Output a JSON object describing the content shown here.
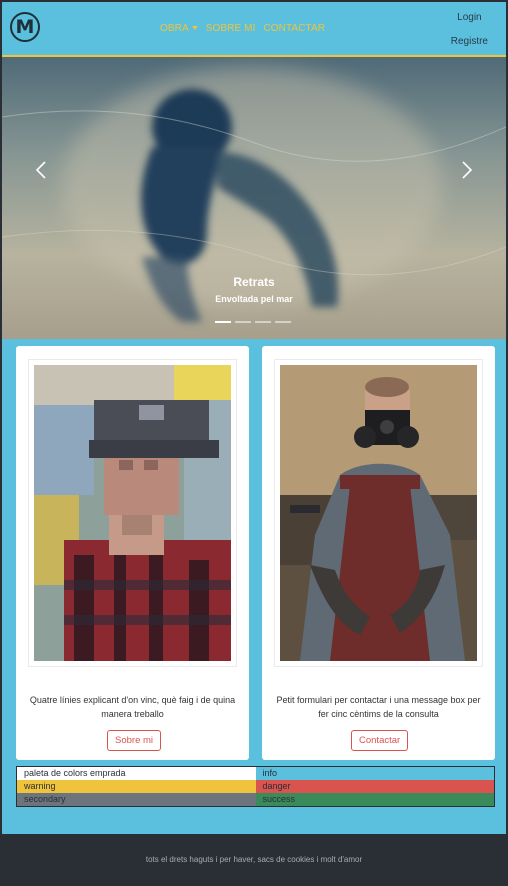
{
  "brand": {
    "logo_letter": "M"
  },
  "nav": {
    "items": [
      {
        "label": "OBRA",
        "has_dropdown": true
      },
      {
        "label": "SOBRE MI",
        "has_dropdown": false
      },
      {
        "label": "CONTACTAR",
        "has_dropdown": false
      }
    ],
    "login_label": "Login",
    "register_label": "Registre"
  },
  "carousel": {
    "caption_title": "Retrats",
    "caption_subtitle": "Envoltada pel mar",
    "slide_count": 4,
    "active_index": 0
  },
  "cards": [
    {
      "text": "Quatre línies explicant d'on vinc, què faig i de quina manera treballo",
      "button_label": "Sobre mi"
    },
    {
      "text": "Petit formulari per contactar i una message box per fer cinc cèntims de la consulta",
      "button_label": "Contactar"
    }
  ],
  "palette": {
    "rows": [
      [
        {
          "label": "paleta de colors emprada",
          "color": "#ffffff"
        },
        {
          "label": "info",
          "color": "#5bc0de"
        }
      ],
      [
        {
          "label": "warning",
          "color": "#f0c33c"
        },
        {
          "label": "danger",
          "color": "#d9534f"
        }
      ],
      [
        {
          "label": "secondary",
          "color": "#6c757d"
        },
        {
          "label": "success",
          "color": "#3a8a5a"
        }
      ]
    ]
  },
  "footer": {
    "text": "tots el drets haguts i per haver, sacs de cookies i molt d'amor"
  },
  "colors": {
    "accent": "#f0c33c",
    "info": "#5bc0de",
    "danger": "#d9534f",
    "dark": "#2a2f36"
  }
}
